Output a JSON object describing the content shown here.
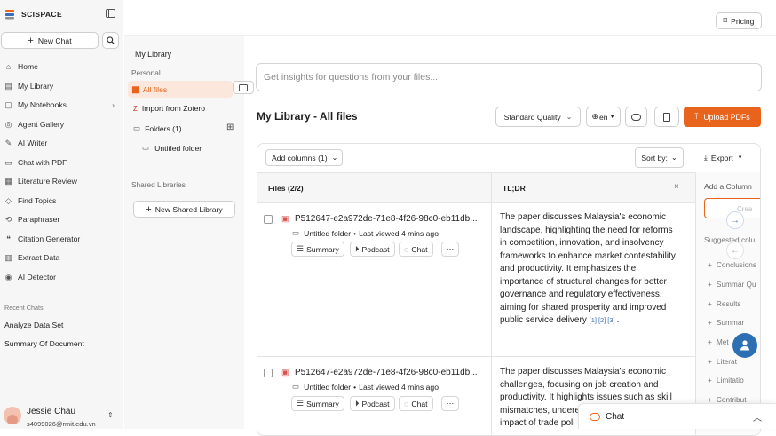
{
  "brand": {
    "name": "SCISPACE"
  },
  "sidebar": {
    "new_chat": "New Chat",
    "items": [
      {
        "label": "Home",
        "icon": "home-icon"
      },
      {
        "label": "My Library",
        "icon": "library-icon"
      },
      {
        "label": "My Notebooks",
        "icon": "notebook-icon"
      },
      {
        "label": "Agent Gallery",
        "icon": "agent-icon"
      },
      {
        "label": "AI Writer",
        "icon": "pen-icon"
      },
      {
        "label": "Chat with PDF",
        "icon": "chat-pdf-icon"
      },
      {
        "label": "Literature Review",
        "icon": "review-icon"
      },
      {
        "label": "Find Topics",
        "icon": "topics-icon"
      },
      {
        "label": "Paraphraser",
        "icon": "paraphrase-icon"
      },
      {
        "label": "Citation Generator",
        "icon": "citation-icon"
      },
      {
        "label": "Extract Data",
        "icon": "extract-icon"
      },
      {
        "label": "AI Detector",
        "icon": "detector-icon"
      }
    ],
    "recent_title": "Recent Chats",
    "recent": [
      "Analyze Data Set",
      "Summary Of Document"
    ],
    "user": {
      "name": "Jessie Chau",
      "email": "s4099026@rmit.edu.vn"
    }
  },
  "header": {
    "pricing": "Pricing"
  },
  "library": {
    "title": "My Library",
    "personal": "Personal",
    "all_files": "All files",
    "import_zotero": "Import from Zotero",
    "folders": "Folders (1)",
    "untitled_folder": "Untitled folder",
    "shared": "Shared Libraries",
    "new_shared": "New Shared Library"
  },
  "main": {
    "search_placeholder": "Get insights for questions from your files...",
    "title": "My Library - All files",
    "quality": "Standard Quality",
    "lang": "en",
    "upload": "Upload PDFs",
    "add_columns": "Add columns (1)",
    "sort": "Sort by:",
    "export": "Export",
    "col_files": "Files (2/2)",
    "col_tldr": "TL;DR",
    "rows": [
      {
        "name": "P512647-e2a972de-71e8-4f26-98c0-eb11db...",
        "folder": "Untitled folder",
        "viewed": "Last viewed 4 mins ago",
        "summary": "Summary",
        "podcast": "Podcast",
        "chat": "Chat",
        "tldr": [
          "The paper discusses Malaysia's economic",
          "landscape, highlighting the need for reforms",
          "in competition, innovation, and insolvency",
          "frameworks to enhance market contestability",
          "and productivity. It emphasizes the",
          "importance of structural changes for better",
          "governance and regulatory effectiveness,",
          "aiming for shared prosperity and improved",
          "public service delivery"
        ],
        "cites": [
          "[1]",
          "[2]",
          "[3]"
        ]
      },
      {
        "name": "P512647-e2a972de-71e8-4f26-98c0-eb11db...",
        "folder": "Untitled folder",
        "viewed": "Last viewed 4 mins ago",
        "summary": "Summary",
        "podcast": "Podcast",
        "chat": "Chat",
        "tldr": [
          "The paper discusses Malaysia's economic",
          "challenges, focusing on job creation and",
          "productivity. It highlights issues such as skill",
          "mismatches, undere",
          "impact of trade poli"
        ]
      }
    ],
    "add_column": {
      "title": "Add a Column",
      "input_placeholder": "Crea",
      "suggested": "Suggested colu",
      "items": [
        "Conclusions",
        "Summar Qu",
        "Results",
        "Summar",
        "Met",
        "Literat",
        "Limitatio",
        "Contribut"
      ]
    }
  },
  "chat_widget": {
    "label": "Chat"
  },
  "colors": {
    "accent": "#e8641c",
    "sidebar_bg": "#f6f6f6",
    "link": "#3a6db8"
  }
}
